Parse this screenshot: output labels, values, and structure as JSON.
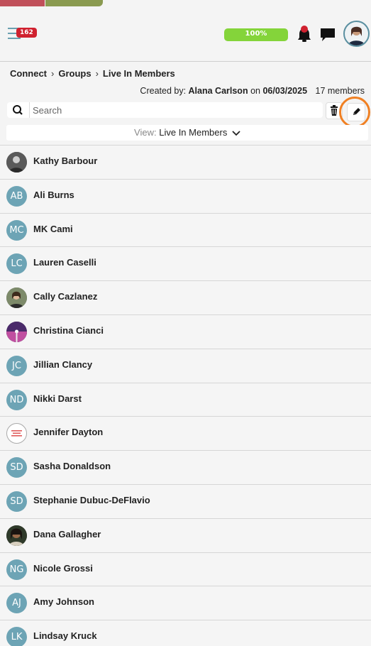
{
  "header": {
    "notification_count": "162",
    "progress_label": "100%",
    "progress_value": 100
  },
  "breadcrumb": {
    "items": [
      "Connect",
      "Groups",
      "Live In Members"
    ]
  },
  "group_meta": {
    "created_by_label": "Created by:",
    "creator": "Alana Carlson",
    "on_label": "on",
    "date": "06/03/2025",
    "members_count": "17 members"
  },
  "search": {
    "placeholder": "Search"
  },
  "view": {
    "label": "View:",
    "value": "Live In Members"
  },
  "members": [
    {
      "name": "Kathy Barbour",
      "initials": "",
      "avatar": "photo"
    },
    {
      "name": "Ali Burns",
      "initials": "AB",
      "avatar": "initials"
    },
    {
      "name": "MK Cami",
      "initials": "MC",
      "avatar": "initials"
    },
    {
      "name": "Lauren Caselli",
      "initials": "LC",
      "avatar": "initials"
    },
    {
      "name": "Cally Cazlanez",
      "initials": "",
      "avatar": "photo"
    },
    {
      "name": "Christina Cianci",
      "initials": "",
      "avatar": "photo"
    },
    {
      "name": "Jillian Clancy",
      "initials": "JC",
      "avatar": "initials"
    },
    {
      "name": "Nikki Darst",
      "initials": "ND",
      "avatar": "initials"
    },
    {
      "name": "Jennifer Dayton",
      "initials": "",
      "avatar": "logo"
    },
    {
      "name": "Sasha Donaldson",
      "initials": "SD",
      "avatar": "initials"
    },
    {
      "name": "Stephanie Dubuc-DeFlavio",
      "initials": "SD",
      "avatar": "initials"
    },
    {
      "name": "Dana Gallagher",
      "initials": "",
      "avatar": "photo"
    },
    {
      "name": "Nicole Grossi",
      "initials": "NG",
      "avatar": "initials"
    },
    {
      "name": "Amy Johnson",
      "initials": "AJ",
      "avatar": "initials"
    },
    {
      "name": "Lindsay Kruck",
      "initials": "LK",
      "avatar": "initials"
    }
  ],
  "colors": {
    "accent": "#6da4b5",
    "badge": "#d0212f",
    "progress": "#84d43a",
    "highlight_ring": "#f08023"
  }
}
